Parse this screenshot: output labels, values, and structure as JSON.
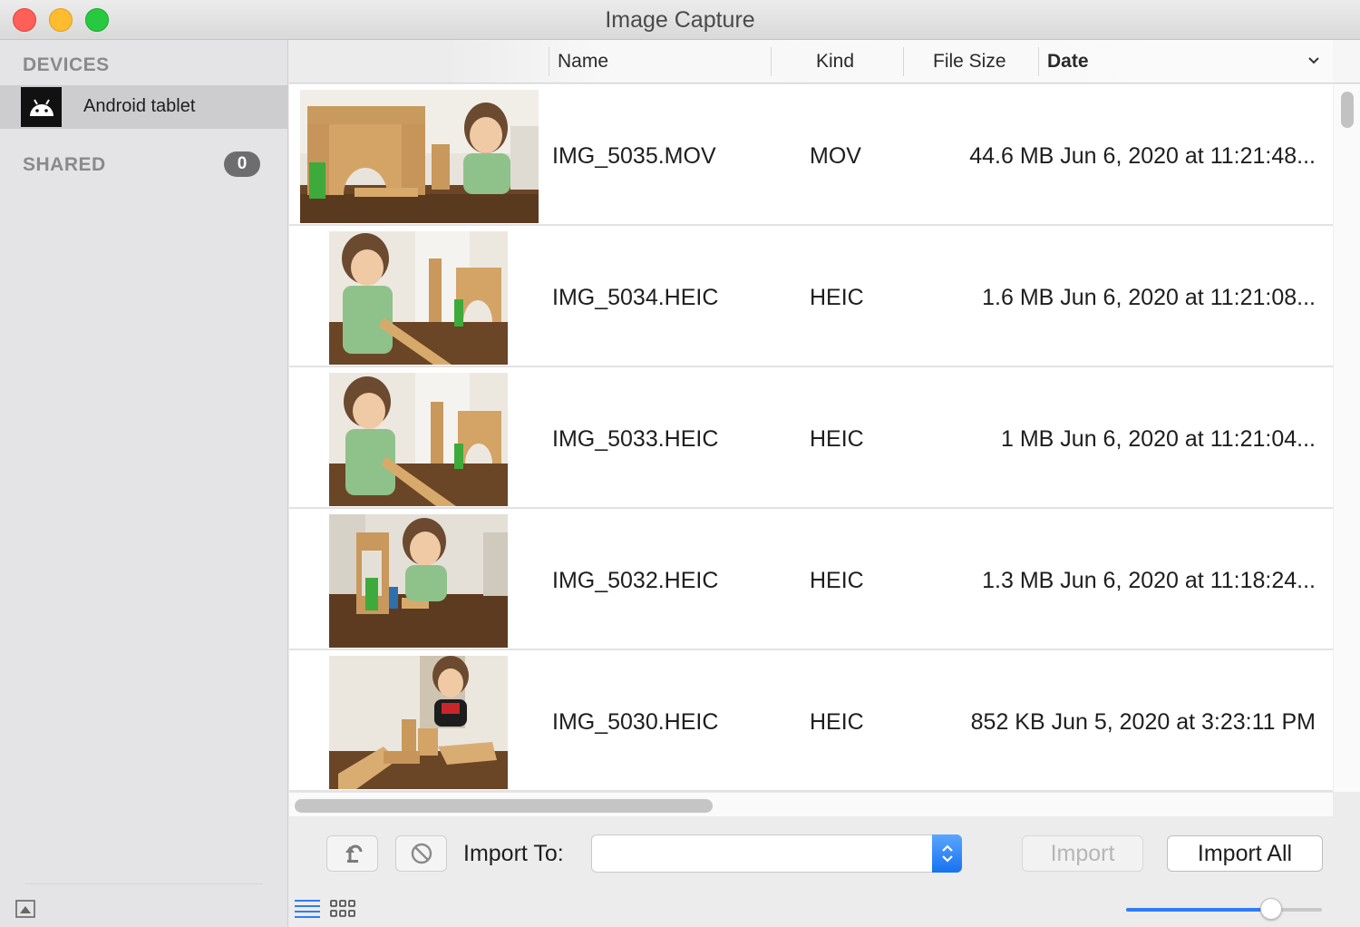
{
  "window": {
    "title": "Image Capture"
  },
  "sidebar": {
    "devices_header": "DEVICES",
    "device_label": "Android tablet",
    "shared_header": "SHARED",
    "shared_count": "0"
  },
  "columns": {
    "name": "Name",
    "kind": "Kind",
    "file_size": "File Size",
    "date": "Date"
  },
  "rows": [
    {
      "name": "IMG_5035.MOV",
      "kind": "MOV",
      "info": "44.6 MB Jun 6, 2020 at 11:21:48..."
    },
    {
      "name": "IMG_5034.HEIC",
      "kind": "HEIC",
      "info": "1.6 MB Jun 6, 2020 at 11:21:08..."
    },
    {
      "name": "IMG_5033.HEIC",
      "kind": "HEIC",
      "info": "1 MB Jun 6, 2020 at 11:21:04..."
    },
    {
      "name": "IMG_5032.HEIC",
      "kind": "HEIC",
      "info": "1.3 MB Jun 6, 2020 at 11:18:24..."
    },
    {
      "name": "IMG_5030.HEIC",
      "kind": "HEIC",
      "info": "852 KB Jun 5, 2020 at 3:23:11 PM"
    }
  ],
  "toolbar": {
    "import_to_label": "Import To:",
    "import_to_value": "",
    "import_label": "Import",
    "import_all_label": "Import All",
    "thumbnail_size": 0.74
  },
  "colors": {
    "accent": "#2f7cf6",
    "selected_row": "#cdcdd0"
  }
}
